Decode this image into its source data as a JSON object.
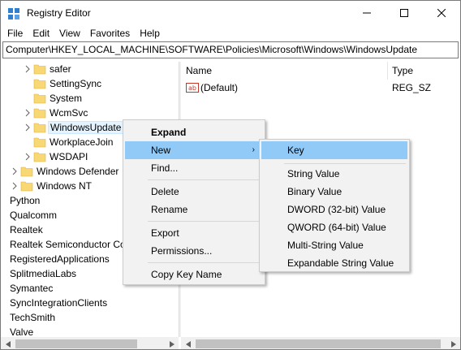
{
  "window": {
    "title": "Registry Editor",
    "minimize_glyph": "minimize-icon",
    "maximize_glyph": "maximize-icon",
    "close_glyph": "close-icon"
  },
  "menubar": {
    "items": [
      "File",
      "Edit",
      "View",
      "Favorites",
      "Help"
    ]
  },
  "address": {
    "path": "Computer\\HKEY_LOCAL_MACHINE\\SOFTWARE\\Policies\\Microsoft\\Windows\\WindowsUpdate"
  },
  "tree": {
    "items": [
      {
        "label": "safer",
        "level": 2,
        "expandable": true,
        "folder": true,
        "selected": false
      },
      {
        "label": "SettingSync",
        "level": 2,
        "expandable": false,
        "folder": true,
        "selected": false
      },
      {
        "label": "System",
        "level": 2,
        "expandable": false,
        "folder": true,
        "selected": false
      },
      {
        "label": "WcmSvc",
        "level": 2,
        "expandable": true,
        "folder": true,
        "selected": false
      },
      {
        "label": "WindowsUpdate",
        "level": 2,
        "expandable": true,
        "folder": true,
        "selected": true
      },
      {
        "label": "WorkplaceJoin",
        "level": 2,
        "expandable": false,
        "folder": true,
        "selected": false
      },
      {
        "label": "WSDAPI",
        "level": 2,
        "expandable": true,
        "folder": true,
        "selected": false
      },
      {
        "label": "Windows Defender",
        "level": 1,
        "expandable": true,
        "folder": true,
        "selected": false
      },
      {
        "label": "Windows NT",
        "level": 1,
        "expandable": true,
        "folder": true,
        "selected": false
      },
      {
        "label": "Python",
        "level": 0,
        "expandable": false,
        "folder": false,
        "selected": false
      },
      {
        "label": "Qualcomm",
        "level": 0,
        "expandable": false,
        "folder": false,
        "selected": false
      },
      {
        "label": "Realtek",
        "level": 0,
        "expandable": false,
        "folder": false,
        "selected": false
      },
      {
        "label": "Realtek Semiconductor Co",
        "level": 0,
        "expandable": false,
        "folder": false,
        "selected": false
      },
      {
        "label": "RegisteredApplications",
        "level": 0,
        "expandable": false,
        "folder": false,
        "selected": false
      },
      {
        "label": "SplitmediaLabs",
        "level": 0,
        "expandable": false,
        "folder": false,
        "selected": false
      },
      {
        "label": "Symantec",
        "level": 0,
        "expandable": false,
        "folder": false,
        "selected": false
      },
      {
        "label": "SyncIntegrationClients",
        "level": 0,
        "expandable": false,
        "folder": false,
        "selected": false
      },
      {
        "label": "TechSmith",
        "level": 0,
        "expandable": false,
        "folder": false,
        "selected": false
      },
      {
        "label": "Valve",
        "level": 0,
        "expandable": false,
        "folder": false,
        "selected": false
      }
    ]
  },
  "list": {
    "columns": [
      "Name",
      "Type"
    ],
    "rows": [
      {
        "name": "(Default)",
        "type": "REG_SZ",
        "icon": "string-value-icon"
      }
    ]
  },
  "context_menu": {
    "items": [
      {
        "label": "Expand",
        "bold": true,
        "highlighted": false,
        "submenu": false
      },
      {
        "label": "New",
        "bold": false,
        "highlighted": true,
        "submenu": true,
        "arrow": "›"
      },
      {
        "label": "Find...",
        "bold": false,
        "highlighted": false,
        "submenu": false
      },
      {
        "label": "Delete",
        "bold": false,
        "highlighted": false,
        "submenu": false
      },
      {
        "label": "Rename",
        "bold": false,
        "highlighted": false,
        "submenu": false
      },
      {
        "label": "Export",
        "bold": false,
        "highlighted": false,
        "submenu": false
      },
      {
        "label": "Permissions...",
        "bold": false,
        "highlighted": false,
        "submenu": false
      },
      {
        "label": "Copy Key Name",
        "bold": false,
        "highlighted": false,
        "submenu": false
      }
    ]
  },
  "sub_menu": {
    "items": [
      {
        "label": "Key",
        "highlighted": true
      },
      {
        "label": "String Value",
        "highlighted": false
      },
      {
        "label": "Binary Value",
        "highlighted": false
      },
      {
        "label": "DWORD (32-bit) Value",
        "highlighted": false
      },
      {
        "label": "QWORD (64-bit) Value",
        "highlighted": false
      },
      {
        "label": "Multi-String Value",
        "highlighted": false
      },
      {
        "label": "Expandable String Value",
        "highlighted": false
      }
    ]
  },
  "colors": {
    "highlight": "#91c9f7",
    "menu_bg": "#f2f2f2",
    "folder": "#f8d775",
    "selection": "#e5f3ff",
    "icon_blue": "#2f7fd1"
  }
}
